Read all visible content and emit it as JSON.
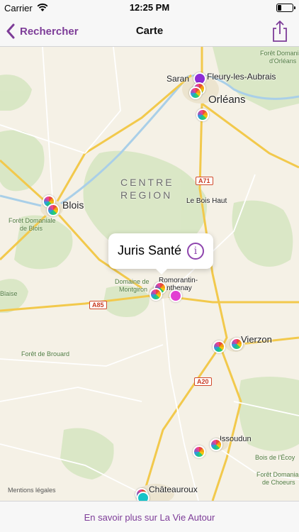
{
  "status_bar": {
    "carrier": "Carrier",
    "time": "12:25 PM",
    "battery_level": 0.25
  },
  "nav": {
    "back_label": "Rechercher",
    "title": "Carte",
    "back_icon": "chevron-left-icon",
    "share_icon": "share-icon"
  },
  "map": {
    "region_label_line1": "CENTRE",
    "region_label_line2": "REGION",
    "cities": {
      "orleans": "Orléans",
      "fleury": "Fleury-les-Aubrais",
      "saran": "Saran",
      "blois": "Blois",
      "le_bois_haut": "Le Bois Haut",
      "romorantin": "Romorantin-Lanthenay",
      "vierzon": "Vierzon",
      "issoudun": "Issoudun",
      "chateauroux": "Châteauroux",
      "blaise": "Blaise"
    },
    "forests": {
      "orleans_forest_line1": "Forêt Domaniale",
      "orleans_forest_line2": "d'Orléans",
      "blois_forest_line1": "Forêt Domaniale",
      "blois_forest_line2": "de Blois",
      "montgiron_line1": "Domaine de",
      "montgiron_line2": "Montgiron",
      "brouard": "Forêt de Brouard",
      "ecouy": "Bois de l'Écoy",
      "choeurs_line1": "Forêt Domaniale",
      "choeurs_line2": "de Choeurs"
    },
    "roads": {
      "a71": "A71",
      "a85": "A85",
      "a20": "A20"
    },
    "callout": {
      "title": "Juris Santé",
      "info_icon": "info-icon"
    },
    "legal": "Mentions légales",
    "colors": {
      "pin_purple": "#8e2bd6",
      "pin_magenta": "#e23fd2",
      "pin_teal": "#17c3c8"
    }
  },
  "bottom": {
    "link": "En savoir plus sur La Vie Autour"
  }
}
